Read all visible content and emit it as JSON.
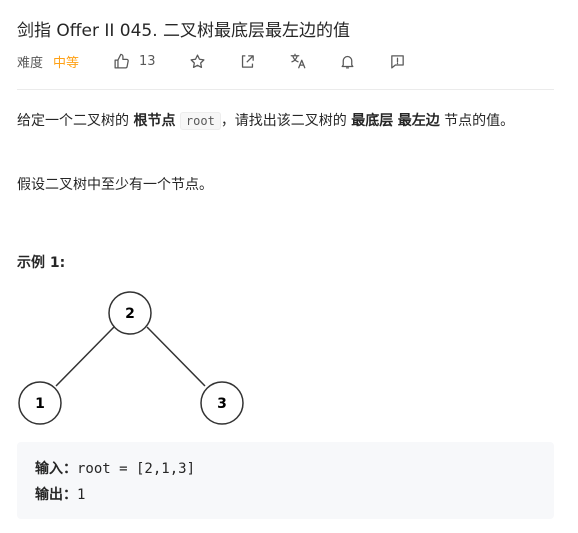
{
  "problem": {
    "title": "剑指 Offer II 045. 二叉树最底层最左边的值",
    "difficulty_label": "难度",
    "difficulty": "中等",
    "likes": "13",
    "colors": {
      "difficulty": "#ffa116",
      "text": "#262626",
      "muted": "#595959"
    }
  },
  "toolbar": {
    "icons": [
      "thumbs-up-icon",
      "star-icon",
      "share-icon",
      "translate-icon",
      "bell-icon",
      "feedback-icon"
    ]
  },
  "description": {
    "p1_before": "给定一个二叉树的 ",
    "p1_bold1": "根节点",
    "p1_code": "root",
    "p1_mid": "，请找出该二叉树的 ",
    "p1_bold2": "最底层",
    "p1_bold3": "最左边",
    "p1_after": " 节点的值。",
    "p2": "假设二叉树中至少有一个节点。"
  },
  "example": {
    "title": "示例 1:",
    "tree_nodes": [
      "2",
      "1",
      "3"
    ],
    "input_label": "输入：",
    "input_value": "root = [2,1,3]",
    "output_label": "输出：",
    "output_value": "1"
  }
}
